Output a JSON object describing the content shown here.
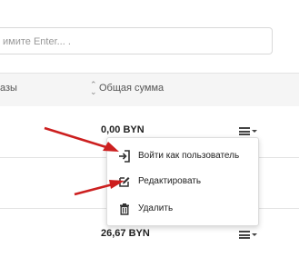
{
  "search": {
    "placeholder": "имите Enter... ."
  },
  "table": {
    "columns": [
      {
        "label": "азы"
      },
      {
        "label": "Общая сумма",
        "sortable": true
      }
    ],
    "rows": [
      {
        "sum": "0,00 BYN"
      },
      {
        "sum": ""
      },
      {
        "sum": "26,67 BYN"
      }
    ]
  },
  "row_menu": {
    "items": [
      {
        "label": "Войти как пользователь",
        "icon": "login-icon"
      },
      {
        "label": "Редактировать",
        "icon": "edit-icon"
      },
      {
        "label": "Удалить",
        "icon": "trash-icon"
      }
    ]
  },
  "annotations": {
    "arrow_color": "#cc1f1f"
  }
}
